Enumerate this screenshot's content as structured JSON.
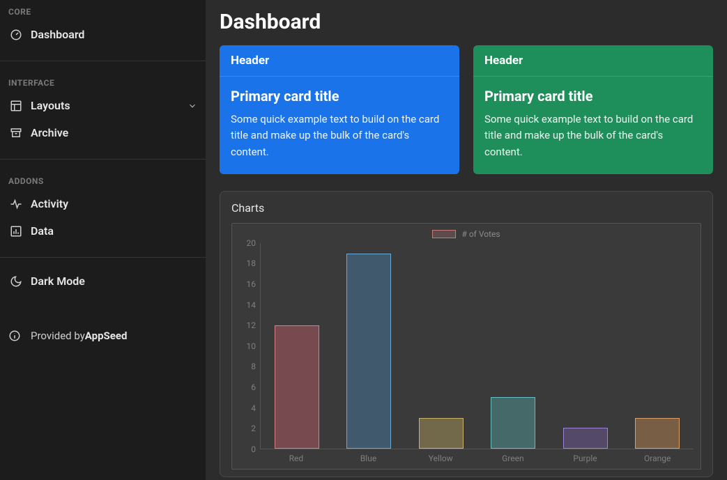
{
  "sidebar": {
    "sections": {
      "core_label": "CORE",
      "interface_label": "INTERFACE",
      "addons_label": "ADDONS"
    },
    "items": {
      "dashboard": "Dashboard",
      "layouts": "Layouts",
      "archive": "Archive",
      "activity": "Activity",
      "data": "Data"
    },
    "dark_mode_label": "Dark Mode",
    "provided_prefix": "Provided by ",
    "provided_brand": "AppSeed"
  },
  "page": {
    "title": "Dashboard"
  },
  "cards": [
    {
      "header": "Header",
      "title": "Primary card title",
      "text": "Some quick example text to build on the card title and make up the bulk of the card's content.",
      "bg": "#1a73e8"
    },
    {
      "header": "Header",
      "title": "Primary card title",
      "text": "Some quick example text to build on the card title and make up the bulk of the card's content.",
      "bg": "#1e8e5a"
    }
  ],
  "chart_panel": {
    "title": "Charts",
    "legend_label": "# of Votes"
  },
  "chart_data": {
    "type": "bar",
    "title": "",
    "xlabel": "",
    "ylabel": "",
    "categories": [
      "Red",
      "Blue",
      "Yellow",
      "Green",
      "Purple",
      "Orange"
    ],
    "values": [
      12,
      19,
      3,
      5,
      2,
      3
    ],
    "ylim": [
      0,
      20
    ],
    "y_ticks": [
      0,
      2,
      4,
      6,
      8,
      10,
      12,
      14,
      16,
      18,
      20
    ],
    "series": [
      {
        "name": "# of Votes",
        "values": [
          12,
          19,
          3,
          5,
          2,
          3
        ]
      }
    ],
    "colors": {
      "fill": [
        "rgba(180,90,100,0.5)",
        "rgba(70,120,160,0.5)",
        "rgba(170,150,90,0.5)",
        "rgba(80,150,150,0.5)",
        "rgba(110,90,150,0.5)",
        "rgba(180,130,80,0.5)"
      ],
      "border": [
        "#d8808a",
        "#6aa9d6",
        "#c9b46a",
        "#63c0c0",
        "#9a82d6",
        "#dba068"
      ]
    }
  }
}
